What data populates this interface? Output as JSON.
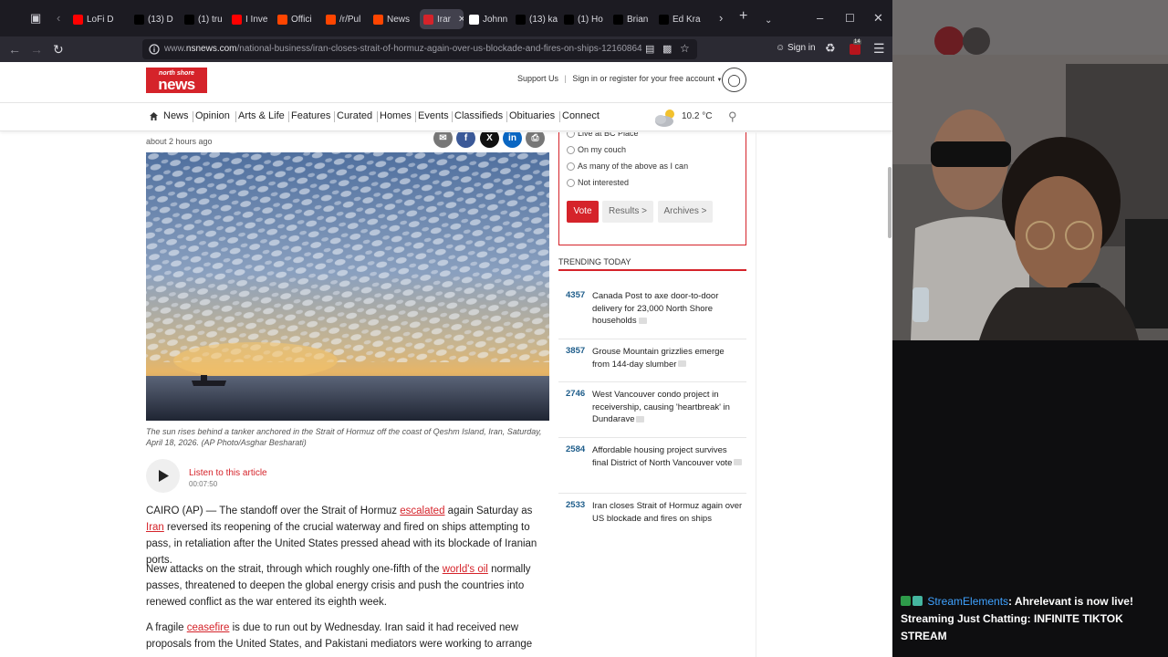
{
  "browser": {
    "tabs": [
      {
        "label": "LoFi D",
        "icon": "youtube-icon",
        "color": "#ff0000"
      },
      {
        "label": "(13) D",
        "icon": "x-icon",
        "color": "#000000"
      },
      {
        "label": "(1) tru",
        "icon": "x-icon",
        "color": "#000000"
      },
      {
        "label": "I Inve",
        "icon": "youtube-icon",
        "color": "#ff0000"
      },
      {
        "label": "Offici",
        "icon": "reddit-icon",
        "color": "#ff4500"
      },
      {
        "label": "/r/Pul",
        "icon": "reddit-icon",
        "color": "#ff4500"
      },
      {
        "label": "News",
        "icon": "reddit-icon",
        "color": "#ff4500"
      },
      {
        "label": "Irar",
        "icon": "nsnews-icon",
        "color": "#d5232a"
      },
      {
        "label": "Johnn",
        "icon": "page-icon",
        "color": "#ffffff"
      },
      {
        "label": "(13) ka",
        "icon": "x-icon",
        "color": "#000000"
      },
      {
        "label": "(1) Ho",
        "icon": "x-icon",
        "color": "#000000"
      },
      {
        "label": "Brian",
        "icon": "x-icon",
        "color": "#000000"
      },
      {
        "label": "Ed Kra",
        "icon": "x-icon",
        "color": "#000000"
      }
    ],
    "url_prefix": "www.",
    "url_host": "nsnews.com",
    "url_path": "/national-business/iran-closes-strait-of-hormuz-again-over-us-blockade-and-fires-on-ships-12160864",
    "sign_in": "Sign in",
    "notification_count": "14"
  },
  "site": {
    "logo_top": "north shore",
    "logo_main": "news",
    "support_link": "Support Us",
    "signin_text": "Sign in or register for your free account",
    "nav": [
      "News",
      "Opinion",
      "Arts & Life",
      "Features",
      "Curated",
      "Homes",
      "Events",
      "Classifieds",
      "Obituaries",
      "Connect"
    ],
    "temperature": "10.2 °C"
  },
  "article": {
    "time": "about 2 hours ago",
    "caption": "The sun rises behind a tanker anchored in the Strait of Hormuz off the coast of Qeshm Island, Iran, Saturday, April 18, 2026. (AP Photo/Asghar Besharati)",
    "listen_label": "Listen to this article",
    "listen_duration": "00:07:50",
    "p1": {
      "a": "CAIRO (AP) — The standoff over the Strait of Hormuz ",
      "link1": "escalated",
      "b": " again Saturday as ",
      "link2": "Iran",
      "c": " reversed its reopening of the crucial waterway and fired on ships attempting to pass, in retaliation after the United States pressed ahead with its blockade of Iranian ports."
    },
    "p2": {
      "a": "New attacks on the strait, through which roughly one-fifth of the ",
      "link1": "world's oil",
      "b": " normally passes, threatened to deepen the global energy crisis and push the countries into renewed conflict as the war entered its eighth week."
    },
    "p3": {
      "a": "A fragile ",
      "link1": "ceasefire",
      "b": " is due to run out by Wednesday. Iran said it had received new proposals from the United States, and Pakistani mediators were working to arrange"
    }
  },
  "poll": {
    "options": [
      "Live at BC Place",
      "On my couch",
      "As many of the above as I can",
      "Not interested"
    ],
    "vote": "Vote",
    "results": "Results >",
    "archives": "Archives >"
  },
  "trending": {
    "heading": "TRENDING TODAY",
    "items": [
      {
        "count": "4357",
        "title": "Canada Post to axe door-to-door delivery for 23,000 North Shore households"
      },
      {
        "count": "3857",
        "title": "Grouse Mountain grizzlies emerge from 144-day slumber"
      },
      {
        "count": "2746",
        "title": "West Vancouver condo project in receivership, causing 'heartbreak' in Dundarave"
      },
      {
        "count": "2584",
        "title": "Affordable housing project survives final District of North Vancouver vote"
      },
      {
        "count": "2533",
        "title": "Iran closes Strait of Hormuz again over US blockade and fires on ships"
      }
    ]
  },
  "stream": {
    "chat_user": "StreamElements",
    "chat_message": ": Ahrelevant is now live! Streaming Just Chatting: INFINITE TIKTOK STREAM"
  },
  "colors": {
    "brand_red": "#d5232a",
    "link_blue": "#1d5c8a",
    "chat_user": "#3fa2ff"
  }
}
